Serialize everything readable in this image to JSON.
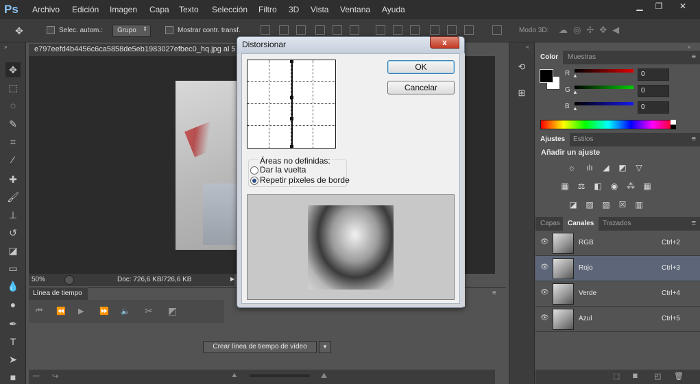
{
  "app": {
    "logo": "Ps",
    "menu": [
      "Archivo",
      "Edición",
      "Imagen",
      "Capa",
      "Texto",
      "Selección",
      "Filtro",
      "3D",
      "Vista",
      "Ventana",
      "Ayuda"
    ]
  },
  "options_bar": {
    "auto_select_label": "Selec. autom.:",
    "group_value": "Grupo",
    "show_transform_label": "Mostrar contr. transf.",
    "mode_3d_label": "Modo 3D:"
  },
  "document": {
    "tab_title": "e797eefd4b4456c6ca5858de5eb1983027efbec0_hq.jpg al 5",
    "zoom": "50%",
    "doc_info": "Doc: 726,6 KB/726,6 KB"
  },
  "timeline": {
    "tab_label": "Línea de tiempo",
    "create_button": "Crear línea de tiempo de vídeo"
  },
  "color_panel": {
    "tabs": [
      "Color",
      "Muestras"
    ],
    "r_label": "R",
    "g_label": "G",
    "b_label": "B",
    "r_value": "0",
    "g_value": "0",
    "b_value": "0"
  },
  "adjustments_panel": {
    "tabs": [
      "Ajustes",
      "Estilos"
    ],
    "heading": "Añadir un ajuste"
  },
  "channels_panel": {
    "tabs": [
      "Capas",
      "Canales",
      "Trazados"
    ],
    "channels": [
      {
        "name": "RGB",
        "shortcut": "Ctrl+2"
      },
      {
        "name": "Rojo",
        "shortcut": "Ctrl+3"
      },
      {
        "name": "Verde",
        "shortcut": "Ctrl+4"
      },
      {
        "name": "Azul",
        "shortcut": "Ctrl+5"
      }
    ]
  },
  "dialog": {
    "title": "Distorsionar",
    "close_label": "x",
    "ok_label": "OK",
    "cancel_label": "Cancelar",
    "undefined_areas_label": "Áreas no definidas:",
    "wrap_around_label": "Dar la vuelta",
    "repeat_edge_label": "Repetir píxeles de borde",
    "selected_option": "Repetir píxeles de borde"
  },
  "colors": {
    "accent_blue": "#8bc4f4",
    "selected_row": "#5d6678",
    "close_red": "#c23a22"
  }
}
